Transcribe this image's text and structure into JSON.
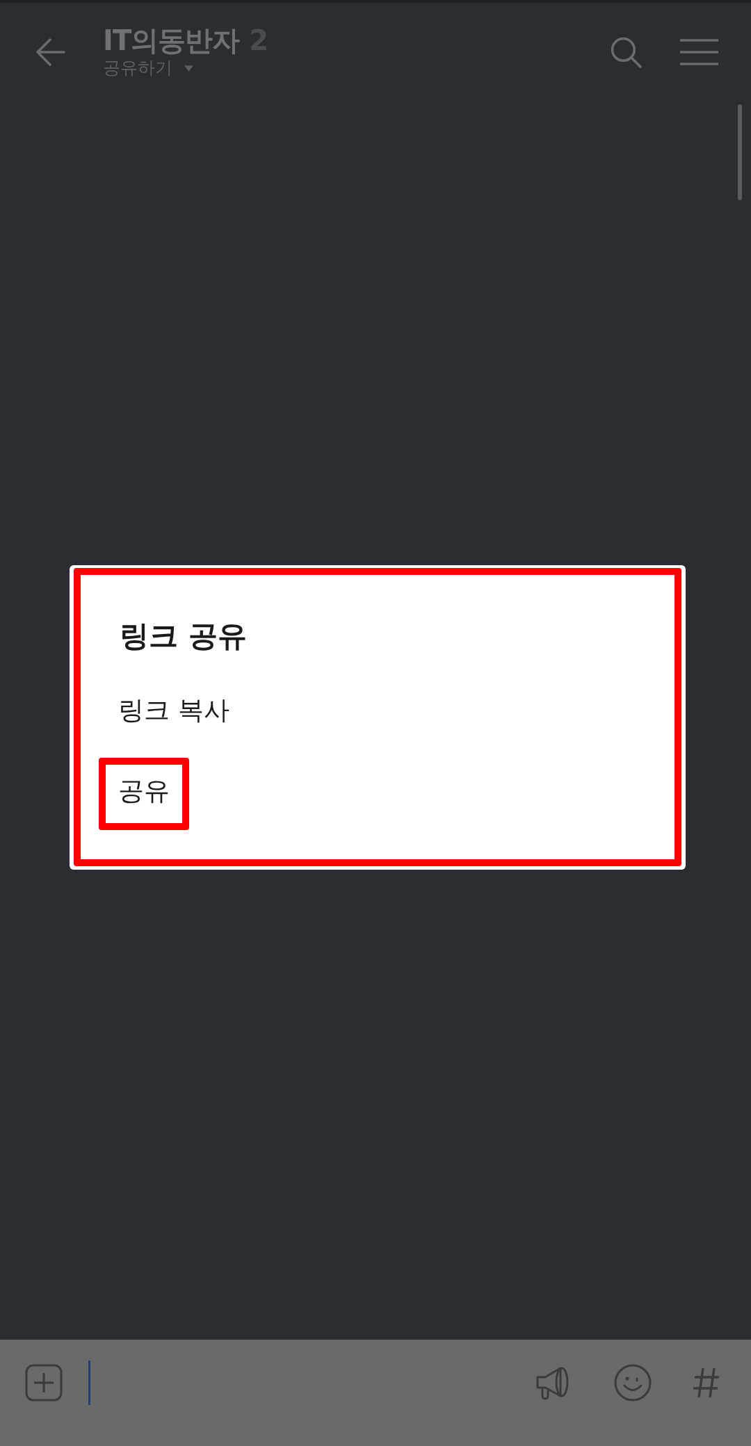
{
  "header": {
    "title": "IT의동반자",
    "member_count": "2",
    "subtitle": "공유하기"
  },
  "dialog": {
    "title": "링크 공유",
    "highlighted": true,
    "options": [
      {
        "label": "링크 복사",
        "highlighted": false
      },
      {
        "label": "공유",
        "highlighted": true
      }
    ]
  }
}
